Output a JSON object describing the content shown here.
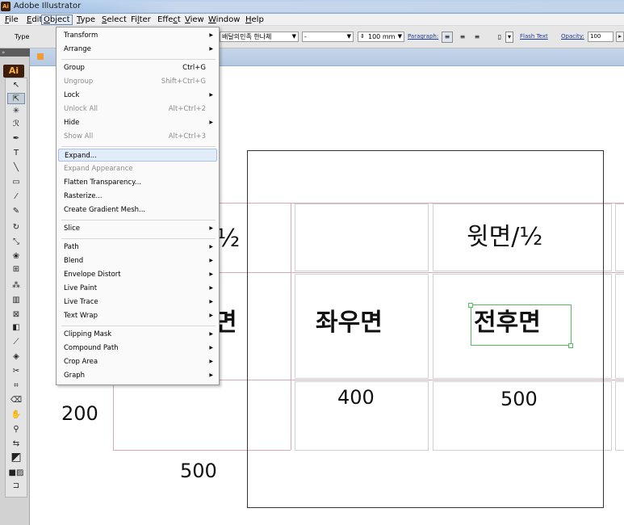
{
  "window": {
    "title": "Adobe Illustrator",
    "app_icon_label": "Ai"
  },
  "menubar": [
    {
      "label": "File",
      "key": "F"
    },
    {
      "label": "Edit",
      "key": "E"
    },
    {
      "label": "Object",
      "key": "O"
    },
    {
      "label": "Type",
      "key": "T"
    },
    {
      "label": "Select",
      "key": "S"
    },
    {
      "label": "Filter",
      "key": "l"
    },
    {
      "label": "Effect",
      "key": "c"
    },
    {
      "label": "View",
      "key": "V"
    },
    {
      "label": "Window",
      "key": "W"
    },
    {
      "label": "Help",
      "key": "H"
    }
  ],
  "controlbar": {
    "type_label": "Type",
    "font_family": "배달의민족 한나체",
    "font_style": "-",
    "font_size": "100 mm",
    "paragraph_label": "Paragraph:",
    "flash_text_label": "Flash Text",
    "opacity_label": "Opacity:",
    "opacity_value": "100"
  },
  "toolbox": {
    "badge": "Ai"
  },
  "object_menu": {
    "items": [
      {
        "label": "Transform",
        "shortcut": "",
        "submenu": true,
        "disabled": false
      },
      {
        "label": "Arrange",
        "shortcut": "",
        "submenu": true,
        "disabled": false
      },
      {
        "label": "Group",
        "shortcut": "Ctrl+G",
        "submenu": false,
        "disabled": false
      },
      {
        "label": "Ungroup",
        "shortcut": "Shift+Ctrl+G",
        "submenu": false,
        "disabled": true
      },
      {
        "label": "Lock",
        "shortcut": "",
        "submenu": true,
        "disabled": false
      },
      {
        "label": "Unlock All",
        "shortcut": "Alt+Ctrl+2",
        "submenu": false,
        "disabled": true
      },
      {
        "label": "Hide",
        "shortcut": "",
        "submenu": true,
        "disabled": false
      },
      {
        "label": "Show All",
        "shortcut": "Alt+Ctrl+3",
        "submenu": false,
        "disabled": true
      },
      {
        "label": "Expand...",
        "shortcut": "",
        "submenu": false,
        "disabled": false,
        "hover": true
      },
      {
        "label": "Expand Appearance",
        "shortcut": "",
        "submenu": false,
        "disabled": true
      },
      {
        "label": "Flatten Transparency...",
        "shortcut": "",
        "submenu": false,
        "disabled": false
      },
      {
        "label": "Rasterize...",
        "shortcut": "",
        "submenu": false,
        "disabled": false
      },
      {
        "label": "Create Gradient Mesh...",
        "shortcut": "",
        "submenu": false,
        "disabled": false
      },
      {
        "label": "Slice",
        "shortcut": "",
        "submenu": true,
        "disabled": false
      },
      {
        "label": "Path",
        "shortcut": "",
        "submenu": true,
        "disabled": false
      },
      {
        "label": "Blend",
        "shortcut": "",
        "submenu": true,
        "disabled": false
      },
      {
        "label": "Envelope Distort",
        "shortcut": "",
        "submenu": true,
        "disabled": false
      },
      {
        "label": "Live Paint",
        "shortcut": "",
        "submenu": true,
        "disabled": false
      },
      {
        "label": "Live Trace",
        "shortcut": "",
        "submenu": true,
        "disabled": false
      },
      {
        "label": "Text Wrap",
        "shortcut": "",
        "submenu": true,
        "disabled": false
      },
      {
        "label": "Clipping Mask",
        "shortcut": "",
        "submenu": true,
        "disabled": false
      },
      {
        "label": "Compound Path",
        "shortcut": "",
        "submenu": true,
        "disabled": false
      },
      {
        "label": "Crop Area",
        "shortcut": "",
        "submenu": true,
        "disabled": false
      },
      {
        "label": "Graph",
        "shortcut": "",
        "submenu": true,
        "disabled": false
      }
    ]
  },
  "canvas": {
    "top_left_fraction": "/½",
    "top_right": "윗면/½",
    "mid_left": "면",
    "mid_center": "좌우면",
    "mid_right": "전후면",
    "num_left": "200",
    "num_center": "400",
    "num_right": "500",
    "num_bottom": "500"
  }
}
